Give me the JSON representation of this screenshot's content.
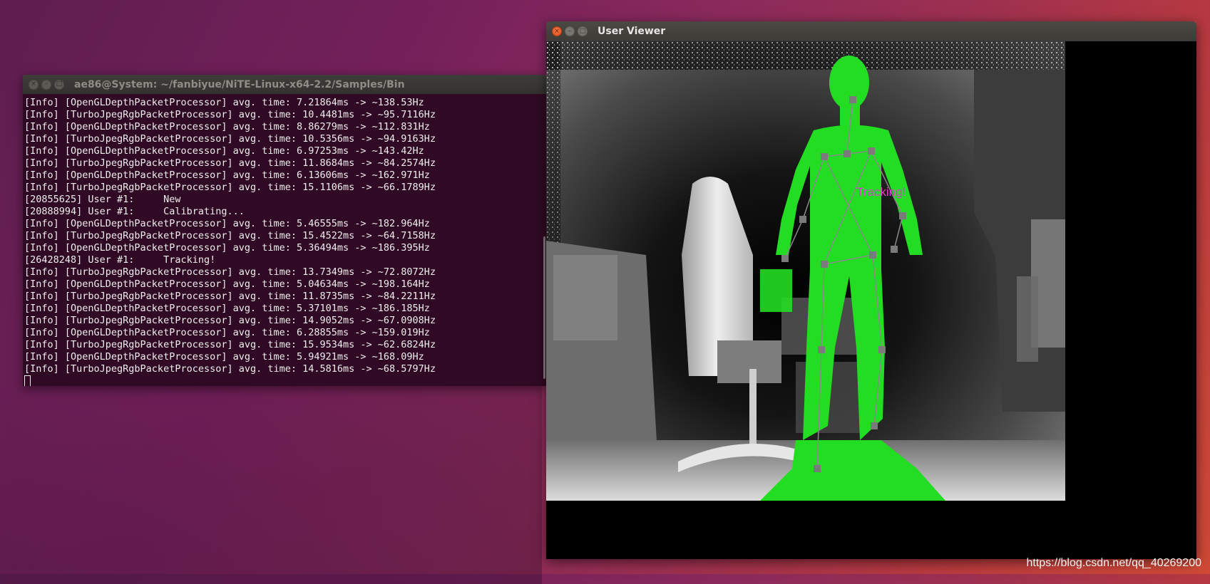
{
  "terminal": {
    "title": "ae86@System: ~/fanbiyue/NiTE-Linux-x64-2.2/Samples/Bin",
    "lines": [
      "[Info] [OpenGLDepthPacketProcessor] avg. time: 7.21864ms -> ~138.53Hz",
      "[Info] [TurboJpegRgbPacketProcessor] avg. time: 10.4481ms -> ~95.7116Hz",
      "[Info] [OpenGLDepthPacketProcessor] avg. time: 8.86279ms -> ~112.831Hz",
      "[Info] [TurboJpegRgbPacketProcessor] avg. time: 10.5356ms -> ~94.9163Hz",
      "[Info] [OpenGLDepthPacketProcessor] avg. time: 6.97253ms -> ~143.42Hz",
      "[Info] [TurboJpegRgbPacketProcessor] avg. time: 11.8684ms -> ~84.2574Hz",
      "[Info] [OpenGLDepthPacketProcessor] avg. time: 6.13606ms -> ~162.971Hz",
      "[Info] [TurboJpegRgbPacketProcessor] avg. time: 15.1106ms -> ~66.1789Hz",
      "[20855625] User #1:     New",
      "[20888994] User #1:     Calibrating...",
      "[Info] [OpenGLDepthPacketProcessor] avg. time: 5.46555ms -> ~182.964Hz",
      "[Info] [TurboJpegRgbPacketProcessor] avg. time: 15.4522ms -> ~64.7158Hz",
      "[Info] [OpenGLDepthPacketProcessor] avg. time: 5.36494ms -> ~186.395Hz",
      "[26428248] User #1:     Tracking!",
      "[Info] [TurboJpegRgbPacketProcessor] avg. time: 13.7349ms -> ~72.8072Hz",
      "[Info] [OpenGLDepthPacketProcessor] avg. time: 5.04634ms -> ~198.164Hz",
      "[Info] [TurboJpegRgbPacketProcessor] avg. time: 11.8735ms -> ~84.2211Hz",
      "[Info] [OpenGLDepthPacketProcessor] avg. time: 5.37101ms -> ~186.185Hz",
      "[Info] [TurboJpegRgbPacketProcessor] avg. time: 14.9052ms -> ~67.0908Hz",
      "[Info] [OpenGLDepthPacketProcessor] avg. time: 6.28855ms -> ~159.019Hz",
      "[Info] [TurboJpegRgbPacketProcessor] avg. time: 15.9534ms -> ~62.6824Hz",
      "[Info] [OpenGLDepthPacketProcessor] avg. time: 5.94921ms -> ~168.09Hz",
      "[Info] [TurboJpegRgbPacketProcessor] avg. time: 14.5816ms -> ~68.5797Hz"
    ]
  },
  "viewer": {
    "title": "User Viewer",
    "status_text": "Tracking!"
  },
  "watermark": "https://blog.csdn.net/qq_40269200",
  "colors": {
    "terminal_bg": "#300a24",
    "terminal_fg": "#eeeeec",
    "user_mask": "#22dd22",
    "skeleton_joint": "#7a7a7a",
    "status_text": "#e53bd4",
    "close_button": "#df4b16"
  },
  "icons": {
    "close": "close-icon",
    "minimize": "minimize-icon",
    "maximize": "maximize-icon"
  }
}
